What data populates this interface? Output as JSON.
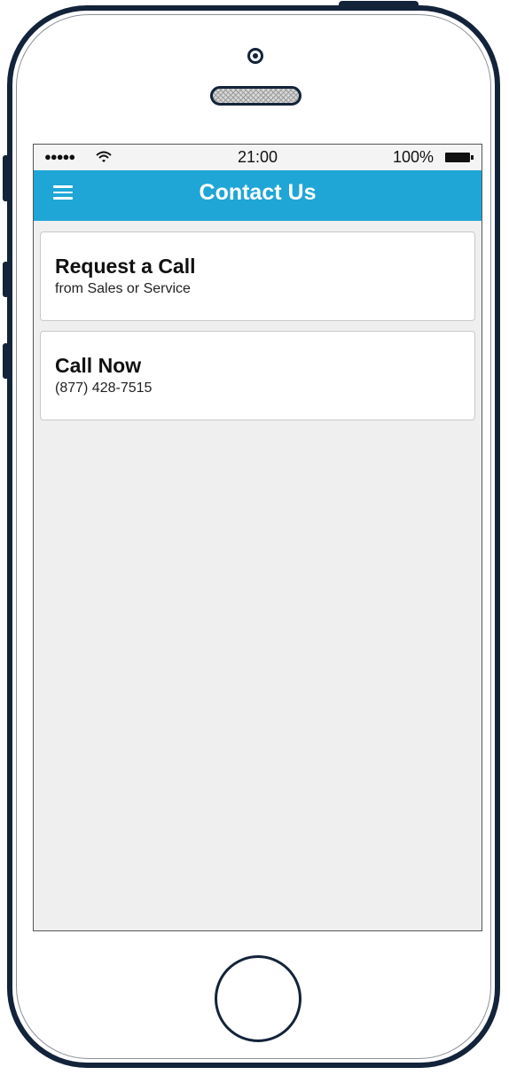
{
  "status_bar": {
    "signal": "●●●●●",
    "time": "21:00",
    "battery_percent": "100%"
  },
  "nav": {
    "title": "Contact Us",
    "menu_icon": "hamburger-menu-icon"
  },
  "cards": [
    {
      "title": "Request a Call",
      "subtitle": "from Sales or Service"
    },
    {
      "title": "Call Now",
      "subtitle": "(877) 428-7515"
    }
  ],
  "colors": {
    "nav_background": "#1fa6d6",
    "screen_background": "#efefef",
    "device_frame": "#13233a"
  }
}
